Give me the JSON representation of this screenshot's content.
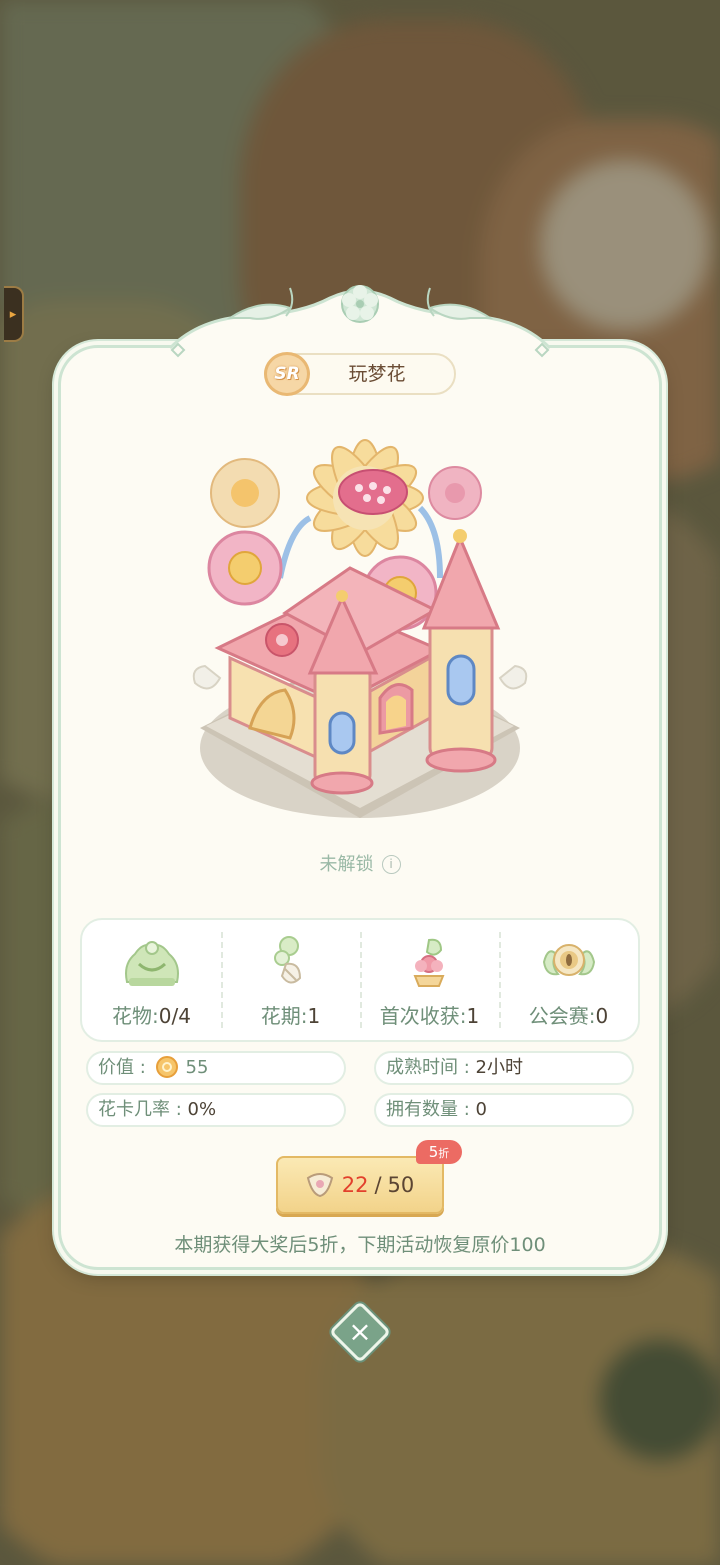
{
  "item": {
    "rarity": "SR",
    "name": "玩梦花",
    "lock_status": "未解锁",
    "info_symbol": "i"
  },
  "stats": [
    {
      "label": "花物",
      "value": "0/4",
      "icon": "flower-plant-icon"
    },
    {
      "label": "花期",
      "value": "1",
      "icon": "flower-bud-icon"
    },
    {
      "label": "首次收获",
      "value": "1",
      "icon": "harvest-icon"
    },
    {
      "label": "公会赛",
      "value": "0",
      "icon": "guild-badge-icon"
    }
  ],
  "details": {
    "value_label": "价值",
    "value_amount": "55",
    "mature_label": "成熟时间",
    "mature_value": "2小时",
    "card_rate_label": "花卡几率",
    "card_rate_value": "0%",
    "owned_label": "拥有数量",
    "owned_value": "0"
  },
  "purchase": {
    "current": "22",
    "separator": "/",
    "total": "50",
    "discount_num": "5",
    "discount_unit": "折"
  },
  "note": "本期获得大奖后5折，下期活动恢复原价100",
  "close_symbol": "×",
  "side_tab_symbol": "▸",
  "colors": {
    "panel_bg": "#fdfbf3",
    "accent_green": "#7aa389",
    "price_red": "#e2402c",
    "sale_tag": "#ec6b63"
  }
}
